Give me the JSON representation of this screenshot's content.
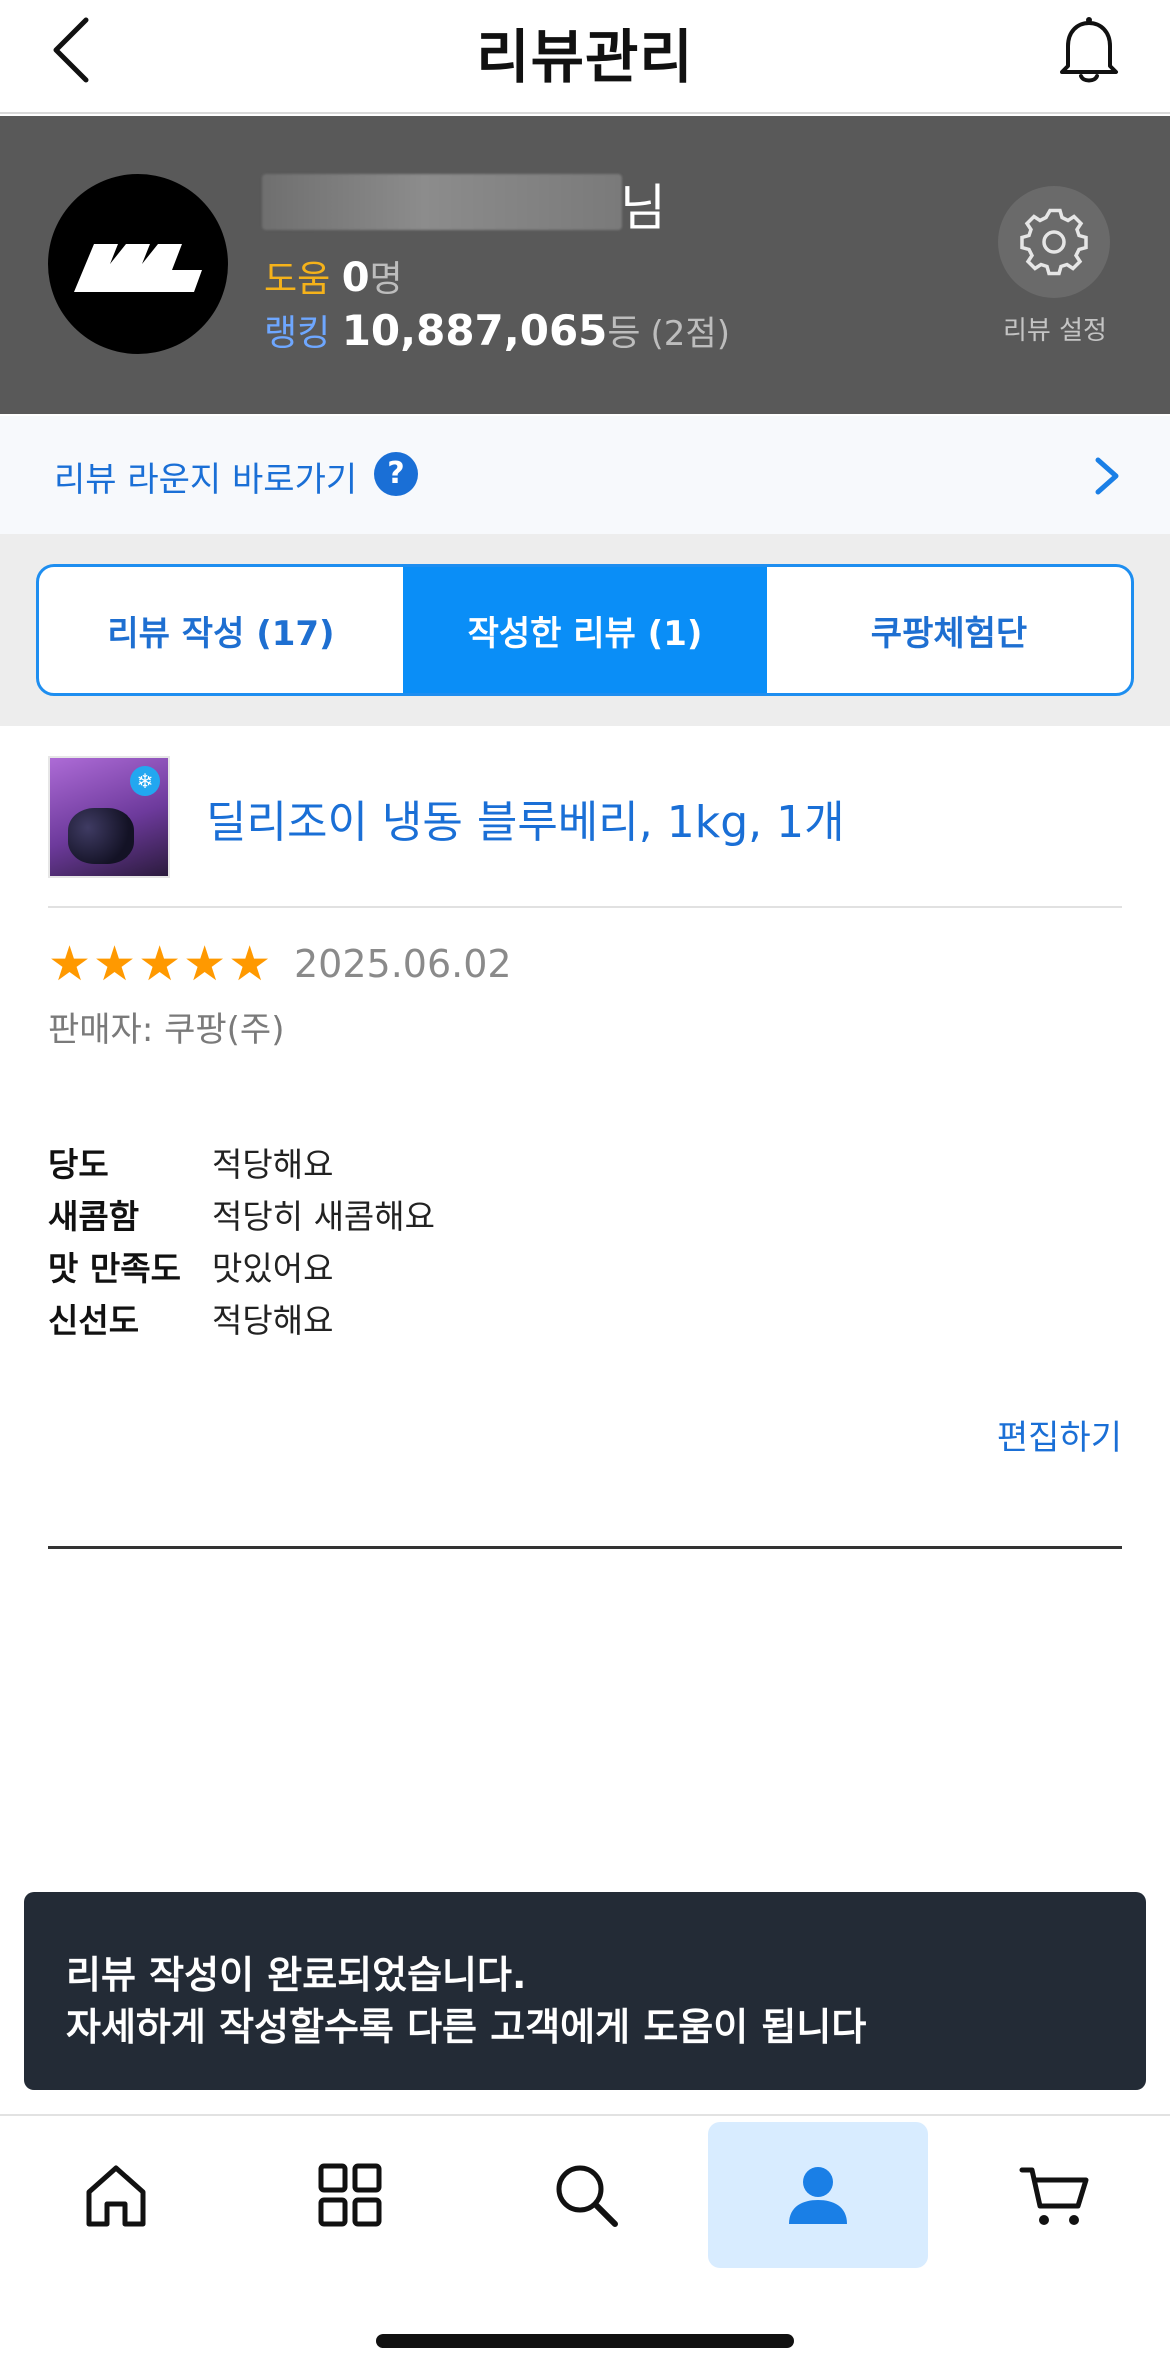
{
  "header": {
    "title": "리뷰관리"
  },
  "profile": {
    "name_suffix": "님",
    "help_label": "도움",
    "help_count": "0",
    "help_unit": "명",
    "rank_label": "랭킹",
    "rank_value": "10,887,065",
    "rank_unit": "등",
    "rank_score": "(2점)",
    "settings_label": "리뷰 설정"
  },
  "lounge": {
    "label": "리뷰 라운지 바로가기",
    "help_badge": "?"
  },
  "tabs": [
    {
      "label": "리뷰 작성 (17)",
      "active": false
    },
    {
      "label": "작성한 리뷰 (1)",
      "active": true
    },
    {
      "label": "쿠팡체험단",
      "active": false
    }
  ],
  "review": {
    "product_title": "딜리조이 냉동 블루베리, 1kg, 1개",
    "rating": 5,
    "date": "2025.06.02",
    "seller": "판매자: 쿠팡(주)",
    "attributes": [
      {
        "key": "당도",
        "value": "적당해요"
      },
      {
        "key": "새콤함",
        "value": "적당히 새콤해요"
      },
      {
        "key": "맛 만족도",
        "value": "맛있어요"
      },
      {
        "key": "신선도",
        "value": "적당해요"
      }
    ],
    "edit_label": "편집하기"
  },
  "toast": {
    "line1": "리뷰 작성이 완료되었습니다.",
    "line2": "자세하게 작성할수록 다른 고객에게 도움이 됩니다"
  },
  "nav": {
    "items": [
      {
        "icon": "home-icon",
        "active": false
      },
      {
        "icon": "category-grid-icon",
        "active": false
      },
      {
        "icon": "search-icon",
        "active": false
      },
      {
        "icon": "person-icon",
        "active": true
      },
      {
        "icon": "cart-icon",
        "active": false
      }
    ]
  },
  "colors": {
    "accent": "#0a8ef7",
    "link": "#1a6fd6",
    "star": "#ff9900",
    "toast_bg": "#232b36",
    "profile_bg": "#595959"
  }
}
